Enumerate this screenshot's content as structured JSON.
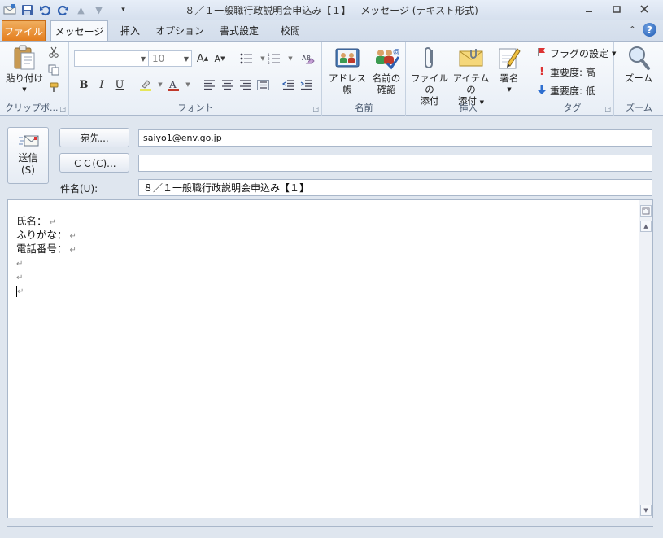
{
  "window": {
    "title": "８／１一般職行政説明会申込み【１】 - メッセージ (テキスト形式)",
    "minimize": "▭",
    "restore": "⧉",
    "close": "✕"
  },
  "qat": {
    "icons": [
      "envelope-icon",
      "save-icon",
      "undo-icon",
      "redo-icon",
      "up-arrow-icon",
      "down-arrow-icon",
      "customize-icon"
    ]
  },
  "tabs": {
    "file": "ファイル",
    "message": "メッセージ",
    "insert": "挿入",
    "options": "オプション",
    "format_text": "書式設定",
    "review": "校閲"
  },
  "ribbon": {
    "clipboard": {
      "paste": "貼り付け",
      "label": "クリップボ..."
    },
    "font": {
      "font_name": "",
      "font_size": "10",
      "bold": "B",
      "italic": "I",
      "underline": "U",
      "label": "フォント"
    },
    "names": {
      "address_book": "アドレス帳",
      "check_names_1": "名前の",
      "check_names_2": "確認",
      "label": "名前"
    },
    "include": {
      "attach_file_1": "ファイルの",
      "attach_file_2": "添付",
      "attach_item_1": "アイテムの",
      "attach_item_2": "添付",
      "signature": "署名",
      "label": "挿入"
    },
    "tags": {
      "follow_up": "フラグの設定",
      "high": "重要度: 高",
      "low": "重要度: 低",
      "label": "タグ"
    },
    "zoom": {
      "zoom": "ズーム",
      "label": "ズーム"
    }
  },
  "compose": {
    "send_1": "送信",
    "send_2": "(S)",
    "to_button": "宛先...",
    "cc_button": "ＣＣ(C)...",
    "subject_label": "件名(U):",
    "to_value": "saiyo1@env.go.jp",
    "cc_value": "",
    "subject_value": "８／１一般職行政説明会申込み【１】"
  },
  "body": {
    "line1": "氏名：",
    "line2": "ふりがな：",
    "line3": "電話番号：",
    "paragraph_mark": "↵"
  },
  "colors": {
    "file_tab": "#e47e1f",
    "accent": "#1f5bb4"
  }
}
